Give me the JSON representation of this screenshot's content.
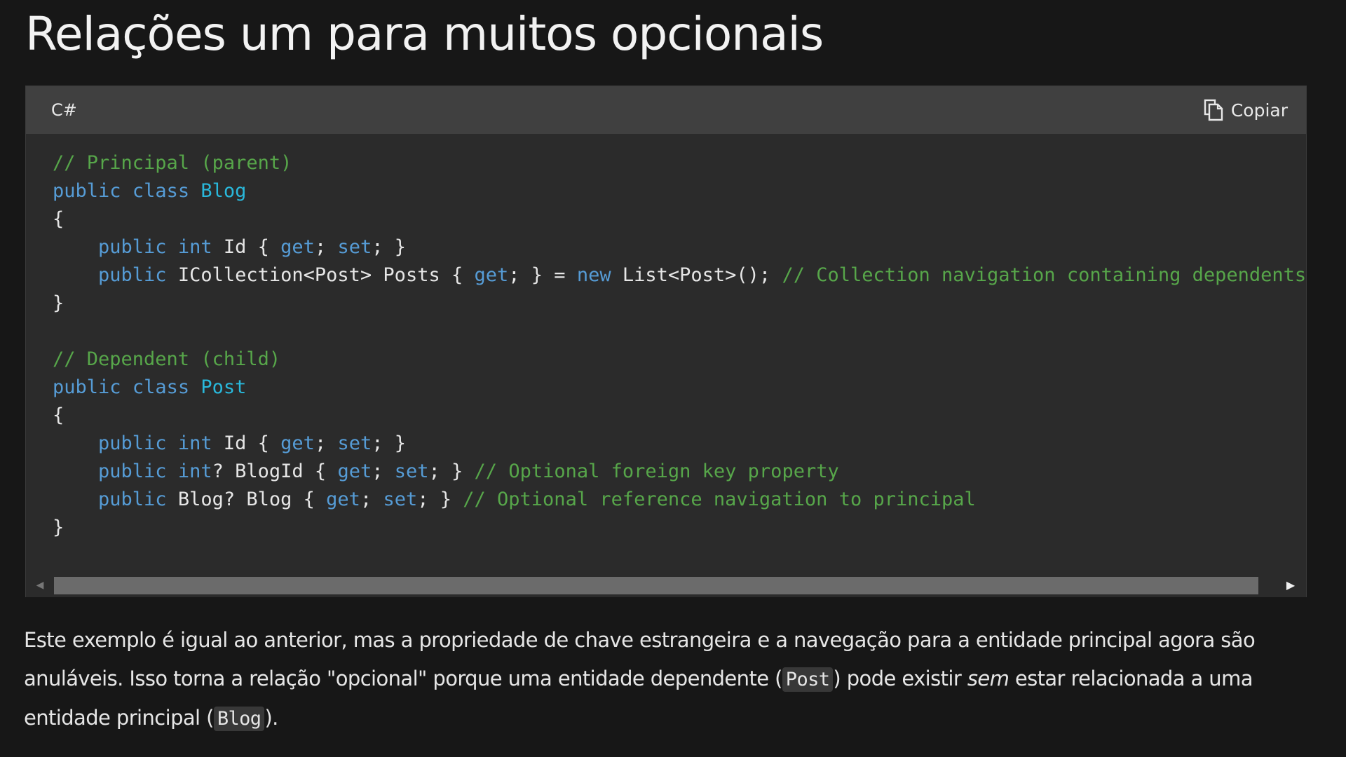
{
  "page": {
    "title": "Relações um para muitos opcionais"
  },
  "code_block": {
    "language": "C#",
    "copy_label": "Copiar",
    "lines": [
      [
        {
          "t": "// Principal (parent)",
          "c": "cm"
        }
      ],
      [
        {
          "t": "public",
          "c": "kw"
        },
        {
          "t": " "
        },
        {
          "t": "class",
          "c": "kw"
        },
        {
          "t": " "
        },
        {
          "t": "Blog",
          "c": "cls"
        }
      ],
      [
        {
          "t": "{"
        }
      ],
      [
        {
          "t": "    "
        },
        {
          "t": "public",
          "c": "kw"
        },
        {
          "t": " "
        },
        {
          "t": "int",
          "c": "kw"
        },
        {
          "t": " Id { "
        },
        {
          "t": "get",
          "c": "kw"
        },
        {
          "t": "; "
        },
        {
          "t": "set",
          "c": "kw"
        },
        {
          "t": "; }"
        }
      ],
      [
        {
          "t": "    "
        },
        {
          "t": "public",
          "c": "kw"
        },
        {
          "t": " ICollection<Post> Posts { "
        },
        {
          "t": "get",
          "c": "kw"
        },
        {
          "t": "; } = "
        },
        {
          "t": "new",
          "c": "kw"
        },
        {
          "t": " List<Post>(); "
        },
        {
          "t": "// Collection navigation containing dependents",
          "c": "cm"
        }
      ],
      [
        {
          "t": "}"
        }
      ],
      [
        {
          "t": ""
        }
      ],
      [
        {
          "t": "// Dependent (child)",
          "c": "cm"
        }
      ],
      [
        {
          "t": "public",
          "c": "kw"
        },
        {
          "t": " "
        },
        {
          "t": "class",
          "c": "kw"
        },
        {
          "t": " "
        },
        {
          "t": "Post",
          "c": "cls"
        }
      ],
      [
        {
          "t": "{"
        }
      ],
      [
        {
          "t": "    "
        },
        {
          "t": "public",
          "c": "kw"
        },
        {
          "t": " "
        },
        {
          "t": "int",
          "c": "kw"
        },
        {
          "t": " Id { "
        },
        {
          "t": "get",
          "c": "kw"
        },
        {
          "t": "; "
        },
        {
          "t": "set",
          "c": "kw"
        },
        {
          "t": "; }"
        }
      ],
      [
        {
          "t": "    "
        },
        {
          "t": "public",
          "c": "kw"
        },
        {
          "t": " "
        },
        {
          "t": "int",
          "c": "kw"
        },
        {
          "t": "? BlogId { "
        },
        {
          "t": "get",
          "c": "kw"
        },
        {
          "t": "; "
        },
        {
          "t": "set",
          "c": "kw"
        },
        {
          "t": "; } "
        },
        {
          "t": "// Optional foreign key property",
          "c": "cm"
        }
      ],
      [
        {
          "t": "    "
        },
        {
          "t": "public",
          "c": "kw"
        },
        {
          "t": " Blog? Blog { "
        },
        {
          "t": "get",
          "c": "kw"
        },
        {
          "t": "; "
        },
        {
          "t": "set",
          "c": "kw"
        },
        {
          "t": "; } "
        },
        {
          "t": "// Optional reference navigation to principal",
          "c": "cm"
        }
      ],
      [
        {
          "t": "}"
        }
      ]
    ]
  },
  "paragraph": {
    "part1": "Este exemplo é igual ao anterior, mas a propriedade de chave estrangeira e a navegação para a entidade principal agora são anuláveis. Isso torna a relação \"opcional\" porque uma entidade dependente (",
    "code1": "Post",
    "part2": ") pode existir ",
    "emphasis": "sem",
    "part3": " estar relacionada a uma entidade principal (",
    "code2": "Blog",
    "part4": ")."
  },
  "icons": {
    "copy": "copy-icon",
    "scroll_left": "triangle-left-icon",
    "scroll_right": "triangle-right-icon"
  }
}
